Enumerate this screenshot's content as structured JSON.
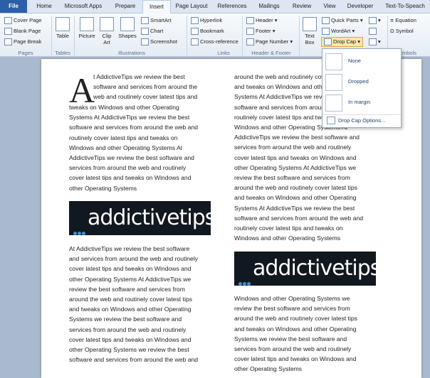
{
  "tabs": [
    "File",
    "Home",
    "Microsoft Apps",
    "Prepare",
    "Insert",
    "Page Layout",
    "References",
    "Mailings",
    "Review",
    "View",
    "Developer",
    "Text-To-Speach"
  ],
  "ribbon": {
    "pages": [
      "Cover Page",
      "Blank Page",
      "Page Break"
    ],
    "table": "Table",
    "picture": "Picture",
    "clip_art": "Clip Art",
    "shapes": "Shapes",
    "illus": [
      "SmartArt",
      "Chart",
      "Screenshot"
    ],
    "links": [
      "Hyperlink",
      "Bookmark",
      "Cross-reference"
    ],
    "hf": [
      "Header",
      "Footer",
      "Page Number"
    ],
    "text_box": "Text Box",
    "text": [
      "Quick Parts",
      "WordArt",
      "Drop Cap"
    ],
    "symbols": [
      "Equation",
      "Symbol"
    ],
    "groups": [
      "Pages",
      "Tables",
      "Illustrations",
      "Links",
      "Header & Footer",
      "mbols"
    ]
  },
  "menu": [
    "None",
    "Dropped",
    "In margin",
    "Drop Cap Options..."
  ],
  "doc": {
    "drop_letter": "A",
    "col1_p1": [
      "t AddictiveTips we review the best",
      "software and services from around the",
      "web and routinely cover latest tips and",
      "tweaks on Windows and other Operating",
      "Systems At AddictiveTips we review the best",
      "software and services from around the web and",
      "routinely cover latest tips and tweaks on",
      "Windows and other Operating Systems At",
      "AddictiveTips we review the best software and",
      "services from around the web and routinely",
      "cover latest tips and tweaks on Windows and",
      "other Operating Systems"
    ],
    "col1_p2": [
      " At AddictiveTips we review the best software",
      "and services from around the web and routinely",
      "cover latest tips and tweaks on Windows and",
      "other Operating Systems At AddictiveTips we",
      "review the best software and services from",
      "around the web and routinely cover latest tips",
      "and tweaks on Windows and other Operating",
      "Systems we review the best software and",
      "services from around the web and routinely",
      "cover latest tips and tweaks on Windows and",
      "other Operating Systems we review the best",
      "software and services from around the web and"
    ],
    "col2_p1": [
      "around the web and routinely cover latest tips",
      "and tweaks on Windows and other Operating",
      "Systems At AddictiveTips we review the best",
      "software and services from around the web and",
      "routinely cover latest tips and tweaks on",
      "Windows and other Operating Systems At",
      "AddictiveTips we review the best software and",
      "services from around the web and routinely",
      "cover latest tips and tweaks on Windows and",
      "other Operating Systems At AddictiveTips we",
      "review the best software and services from",
      "around the web and routinely cover latest tips",
      "and tweaks on Windows and other Operating",
      "Systems At AddictiveTips we review the best",
      "software and services from around the web and",
      "routinely cover latest tips and tweaks on",
      "Windows and other Operating Systems"
    ],
    "col2_p2": [
      "Windows and other Operating Systems we",
      "review the best software and services from",
      "around the web and routinely cover latest tips",
      "and tweaks on Windows and other Operating",
      "Systems we review the best software and",
      "services from around the web and routinely",
      "cover latest tips and tweaks on Windows and",
      "other Operating Systems"
    ],
    "logo_text": "addictivetips"
  },
  "colors": {
    "file_tab": "#2b5fa8",
    "logo_bg": "#12181f",
    "logo_dot": "#3e8fd6"
  }
}
